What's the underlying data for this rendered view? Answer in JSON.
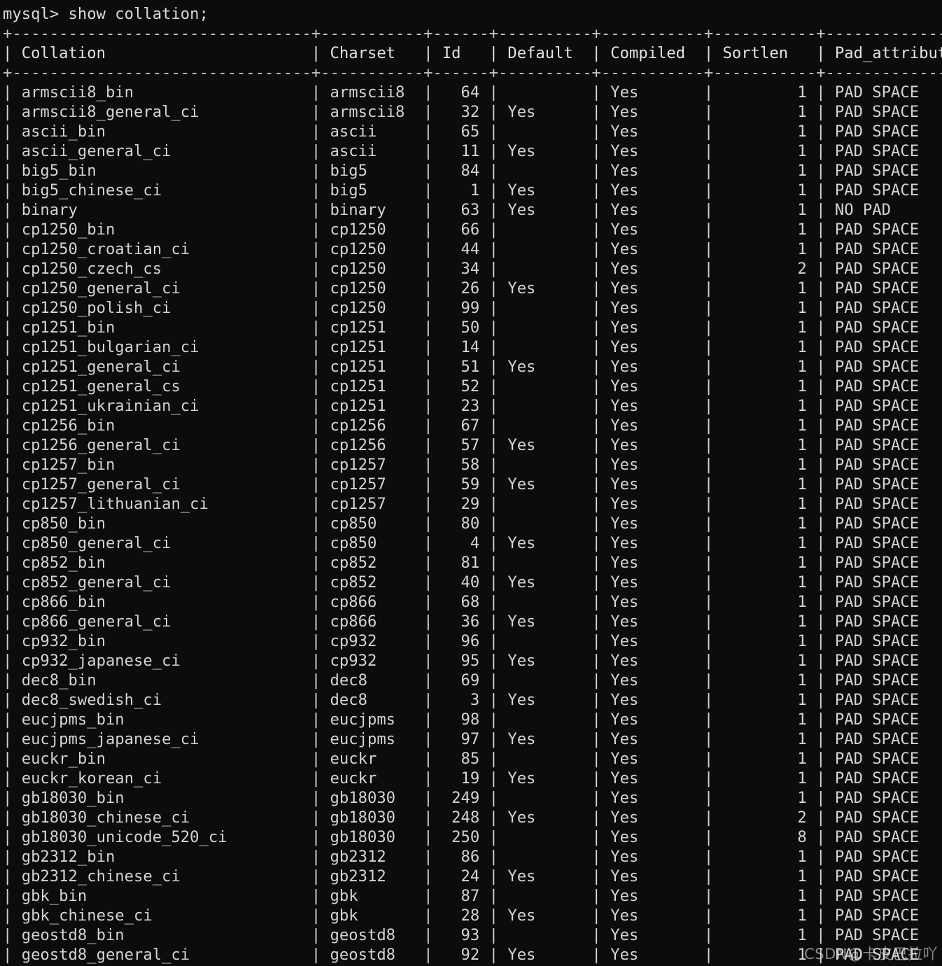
{
  "terminal": {
    "prompt": "mysql> ",
    "command": "show collation;",
    "prompt_line": "mysql> show collation;",
    "background_color": "#0c0c0c",
    "foreground_color": "#d4d4d4"
  },
  "table": {
    "columns": [
      {
        "name": "Collation",
        "width": 30,
        "align": "left"
      },
      {
        "name": "Charset",
        "width": 9,
        "align": "left"
      },
      {
        "name": "Id",
        "width": 4,
        "align": "right"
      },
      {
        "name": "Default",
        "width": 8,
        "align": "left"
      },
      {
        "name": "Compiled",
        "width": 9,
        "align": "left"
      },
      {
        "name": "Sortlen",
        "width": 9,
        "align": "right"
      },
      {
        "name": "Pad_attribute",
        "width": 15,
        "align": "left"
      }
    ],
    "rows": [
      {
        "Collation": "armscii8_bin",
        "Charset": "armscii8",
        "Id": "64",
        "Default": "",
        "Compiled": "Yes",
        "Sortlen": "1",
        "Pad_attribute": "PAD SPACE"
      },
      {
        "Collation": "armscii8_general_ci",
        "Charset": "armscii8",
        "Id": "32",
        "Default": "Yes",
        "Compiled": "Yes",
        "Sortlen": "1",
        "Pad_attribute": "PAD SPACE"
      },
      {
        "Collation": "ascii_bin",
        "Charset": "ascii",
        "Id": "65",
        "Default": "",
        "Compiled": "Yes",
        "Sortlen": "1",
        "Pad_attribute": "PAD SPACE"
      },
      {
        "Collation": "ascii_general_ci",
        "Charset": "ascii",
        "Id": "11",
        "Default": "Yes",
        "Compiled": "Yes",
        "Sortlen": "1",
        "Pad_attribute": "PAD SPACE"
      },
      {
        "Collation": "big5_bin",
        "Charset": "big5",
        "Id": "84",
        "Default": "",
        "Compiled": "Yes",
        "Sortlen": "1",
        "Pad_attribute": "PAD SPACE"
      },
      {
        "Collation": "big5_chinese_ci",
        "Charset": "big5",
        "Id": "1",
        "Default": "Yes",
        "Compiled": "Yes",
        "Sortlen": "1",
        "Pad_attribute": "PAD SPACE"
      },
      {
        "Collation": "binary",
        "Charset": "binary",
        "Id": "63",
        "Default": "Yes",
        "Compiled": "Yes",
        "Sortlen": "1",
        "Pad_attribute": "NO PAD"
      },
      {
        "Collation": "cp1250_bin",
        "Charset": "cp1250",
        "Id": "66",
        "Default": "",
        "Compiled": "Yes",
        "Sortlen": "1",
        "Pad_attribute": "PAD SPACE"
      },
      {
        "Collation": "cp1250_croatian_ci",
        "Charset": "cp1250",
        "Id": "44",
        "Default": "",
        "Compiled": "Yes",
        "Sortlen": "1",
        "Pad_attribute": "PAD SPACE"
      },
      {
        "Collation": "cp1250_czech_cs",
        "Charset": "cp1250",
        "Id": "34",
        "Default": "",
        "Compiled": "Yes",
        "Sortlen": "2",
        "Pad_attribute": "PAD SPACE"
      },
      {
        "Collation": "cp1250_general_ci",
        "Charset": "cp1250",
        "Id": "26",
        "Default": "Yes",
        "Compiled": "Yes",
        "Sortlen": "1",
        "Pad_attribute": "PAD SPACE"
      },
      {
        "Collation": "cp1250_polish_ci",
        "Charset": "cp1250",
        "Id": "99",
        "Default": "",
        "Compiled": "Yes",
        "Sortlen": "1",
        "Pad_attribute": "PAD SPACE"
      },
      {
        "Collation": "cp1251_bin",
        "Charset": "cp1251",
        "Id": "50",
        "Default": "",
        "Compiled": "Yes",
        "Sortlen": "1",
        "Pad_attribute": "PAD SPACE"
      },
      {
        "Collation": "cp1251_bulgarian_ci",
        "Charset": "cp1251",
        "Id": "14",
        "Default": "",
        "Compiled": "Yes",
        "Sortlen": "1",
        "Pad_attribute": "PAD SPACE"
      },
      {
        "Collation": "cp1251_general_ci",
        "Charset": "cp1251",
        "Id": "51",
        "Default": "Yes",
        "Compiled": "Yes",
        "Sortlen": "1",
        "Pad_attribute": "PAD SPACE"
      },
      {
        "Collation": "cp1251_general_cs",
        "Charset": "cp1251",
        "Id": "52",
        "Default": "",
        "Compiled": "Yes",
        "Sortlen": "1",
        "Pad_attribute": "PAD SPACE"
      },
      {
        "Collation": "cp1251_ukrainian_ci",
        "Charset": "cp1251",
        "Id": "23",
        "Default": "",
        "Compiled": "Yes",
        "Sortlen": "1",
        "Pad_attribute": "PAD SPACE"
      },
      {
        "Collation": "cp1256_bin",
        "Charset": "cp1256",
        "Id": "67",
        "Default": "",
        "Compiled": "Yes",
        "Sortlen": "1",
        "Pad_attribute": "PAD SPACE"
      },
      {
        "Collation": "cp1256_general_ci",
        "Charset": "cp1256",
        "Id": "57",
        "Default": "Yes",
        "Compiled": "Yes",
        "Sortlen": "1",
        "Pad_attribute": "PAD SPACE"
      },
      {
        "Collation": "cp1257_bin",
        "Charset": "cp1257",
        "Id": "58",
        "Default": "",
        "Compiled": "Yes",
        "Sortlen": "1",
        "Pad_attribute": "PAD SPACE"
      },
      {
        "Collation": "cp1257_general_ci",
        "Charset": "cp1257",
        "Id": "59",
        "Default": "Yes",
        "Compiled": "Yes",
        "Sortlen": "1",
        "Pad_attribute": "PAD SPACE"
      },
      {
        "Collation": "cp1257_lithuanian_ci",
        "Charset": "cp1257",
        "Id": "29",
        "Default": "",
        "Compiled": "Yes",
        "Sortlen": "1",
        "Pad_attribute": "PAD SPACE"
      },
      {
        "Collation": "cp850_bin",
        "Charset": "cp850",
        "Id": "80",
        "Default": "",
        "Compiled": "Yes",
        "Sortlen": "1",
        "Pad_attribute": "PAD SPACE"
      },
      {
        "Collation": "cp850_general_ci",
        "Charset": "cp850",
        "Id": "4",
        "Default": "Yes",
        "Compiled": "Yes",
        "Sortlen": "1",
        "Pad_attribute": "PAD SPACE"
      },
      {
        "Collation": "cp852_bin",
        "Charset": "cp852",
        "Id": "81",
        "Default": "",
        "Compiled": "Yes",
        "Sortlen": "1",
        "Pad_attribute": "PAD SPACE"
      },
      {
        "Collation": "cp852_general_ci",
        "Charset": "cp852",
        "Id": "40",
        "Default": "Yes",
        "Compiled": "Yes",
        "Sortlen": "1",
        "Pad_attribute": "PAD SPACE"
      },
      {
        "Collation": "cp866_bin",
        "Charset": "cp866",
        "Id": "68",
        "Default": "",
        "Compiled": "Yes",
        "Sortlen": "1",
        "Pad_attribute": "PAD SPACE"
      },
      {
        "Collation": "cp866_general_ci",
        "Charset": "cp866",
        "Id": "36",
        "Default": "Yes",
        "Compiled": "Yes",
        "Sortlen": "1",
        "Pad_attribute": "PAD SPACE"
      },
      {
        "Collation": "cp932_bin",
        "Charset": "cp932",
        "Id": "96",
        "Default": "",
        "Compiled": "Yes",
        "Sortlen": "1",
        "Pad_attribute": "PAD SPACE"
      },
      {
        "Collation": "cp932_japanese_ci",
        "Charset": "cp932",
        "Id": "95",
        "Default": "Yes",
        "Compiled": "Yes",
        "Sortlen": "1",
        "Pad_attribute": "PAD SPACE"
      },
      {
        "Collation": "dec8_bin",
        "Charset": "dec8",
        "Id": "69",
        "Default": "",
        "Compiled": "Yes",
        "Sortlen": "1",
        "Pad_attribute": "PAD SPACE"
      },
      {
        "Collation": "dec8_swedish_ci",
        "Charset": "dec8",
        "Id": "3",
        "Default": "Yes",
        "Compiled": "Yes",
        "Sortlen": "1",
        "Pad_attribute": "PAD SPACE"
      },
      {
        "Collation": "eucjpms_bin",
        "Charset": "eucjpms",
        "Id": "98",
        "Default": "",
        "Compiled": "Yes",
        "Sortlen": "1",
        "Pad_attribute": "PAD SPACE"
      },
      {
        "Collation": "eucjpms_japanese_ci",
        "Charset": "eucjpms",
        "Id": "97",
        "Default": "Yes",
        "Compiled": "Yes",
        "Sortlen": "1",
        "Pad_attribute": "PAD SPACE"
      },
      {
        "Collation": "euckr_bin",
        "Charset": "euckr",
        "Id": "85",
        "Default": "",
        "Compiled": "Yes",
        "Sortlen": "1",
        "Pad_attribute": "PAD SPACE"
      },
      {
        "Collation": "euckr_korean_ci",
        "Charset": "euckr",
        "Id": "19",
        "Default": "Yes",
        "Compiled": "Yes",
        "Sortlen": "1",
        "Pad_attribute": "PAD SPACE"
      },
      {
        "Collation": "gb18030_bin",
        "Charset": "gb18030",
        "Id": "249",
        "Default": "",
        "Compiled": "Yes",
        "Sortlen": "1",
        "Pad_attribute": "PAD SPACE"
      },
      {
        "Collation": "gb18030_chinese_ci",
        "Charset": "gb18030",
        "Id": "248",
        "Default": "Yes",
        "Compiled": "Yes",
        "Sortlen": "2",
        "Pad_attribute": "PAD SPACE"
      },
      {
        "Collation": "gb18030_unicode_520_ci",
        "Charset": "gb18030",
        "Id": "250",
        "Default": "",
        "Compiled": "Yes",
        "Sortlen": "8",
        "Pad_attribute": "PAD SPACE"
      },
      {
        "Collation": "gb2312_bin",
        "Charset": "gb2312",
        "Id": "86",
        "Default": "",
        "Compiled": "Yes",
        "Sortlen": "1",
        "Pad_attribute": "PAD SPACE"
      },
      {
        "Collation": "gb2312_chinese_ci",
        "Charset": "gb2312",
        "Id": "24",
        "Default": "Yes",
        "Compiled": "Yes",
        "Sortlen": "1",
        "Pad_attribute": "PAD SPACE"
      },
      {
        "Collation": "gbk_bin",
        "Charset": "gbk",
        "Id": "87",
        "Default": "",
        "Compiled": "Yes",
        "Sortlen": "1",
        "Pad_attribute": "PAD SPACE"
      },
      {
        "Collation": "gbk_chinese_ci",
        "Charset": "gbk",
        "Id": "28",
        "Default": "Yes",
        "Compiled": "Yes",
        "Sortlen": "1",
        "Pad_attribute": "PAD SPACE"
      },
      {
        "Collation": "geostd8_bin",
        "Charset": "geostd8",
        "Id": "93",
        "Default": "",
        "Compiled": "Yes",
        "Sortlen": "1",
        "Pad_attribute": "PAD SPACE"
      },
      {
        "Collation": "geostd8_general_ci",
        "Charset": "geostd8",
        "Id": "92",
        "Default": "Yes",
        "Compiled": "Yes",
        "Sortlen": "1",
        "Pad_attribute": "PAD SPACE"
      }
    ]
  },
  "watermark": {
    "text": "CSDN@卡皮巴拉吖"
  }
}
